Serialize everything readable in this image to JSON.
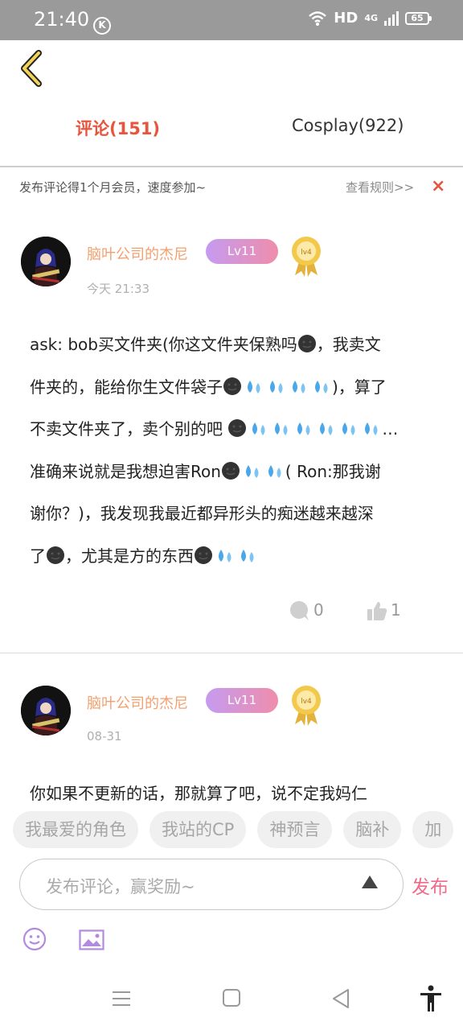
{
  "status_bar": {
    "time": "21:40",
    "k_badge": "K",
    "network": "HD",
    "cell": "4G",
    "battery": "65"
  },
  "tabs": [
    {
      "label": "评论(151)",
      "active": true
    },
    {
      "label": "Cosplay(922)",
      "active": false
    }
  ],
  "notice": {
    "text": "发布评论得1个月会员，速度参加~",
    "rules_link": "查看规则>>",
    "close": "×"
  },
  "comments": [
    {
      "username": "脑叶公司的杰尼",
      "level": "Lv11",
      "medal_text": "lv4",
      "time": "今天 21:33",
      "lines": [
        "ask: bob买文件夹(你这文件夹保熟吗",
        "，我卖文",
        "件夹的，能给你生文件袋子",
        ")，算了",
        "不卖文件夹了，卖个别的吧 ",
        "…",
        "准确来说就是我想迫害Ron",
        "( Ron:那我谢",
        "谢你？)，我发现我最近都异形头的痴迷越来越深",
        "了",
        "，尤其是方的东西"
      ],
      "reply_count": "0",
      "like_count": "1"
    },
    {
      "username": "脑叶公司的杰尼",
      "level": "Lv11",
      "medal_text": "lv4",
      "time": "08-31",
      "lines": [
        "你如果不更新的话，那就算了吧，说不定我妈仁"
      ]
    }
  ],
  "quick_tags": [
    "我最爱的角色",
    "我站的CP",
    "神预言",
    "脑补",
    "加"
  ],
  "input": {
    "placeholder": "发布评论，赢奖励~",
    "publish": "发布"
  },
  "colors": {
    "accent": "#e7553e",
    "username": "#f3a06f",
    "publish": "#ee6b8a",
    "level_start": "#c59bf0",
    "level_end": "#ef8dab"
  },
  "icons": [
    "back-icon",
    "emoji-icon",
    "image-icon",
    "comment-icon",
    "thumbs-up-icon",
    "menu-icon",
    "home-icon",
    "back-triangle-icon",
    "accessibility-icon"
  ]
}
